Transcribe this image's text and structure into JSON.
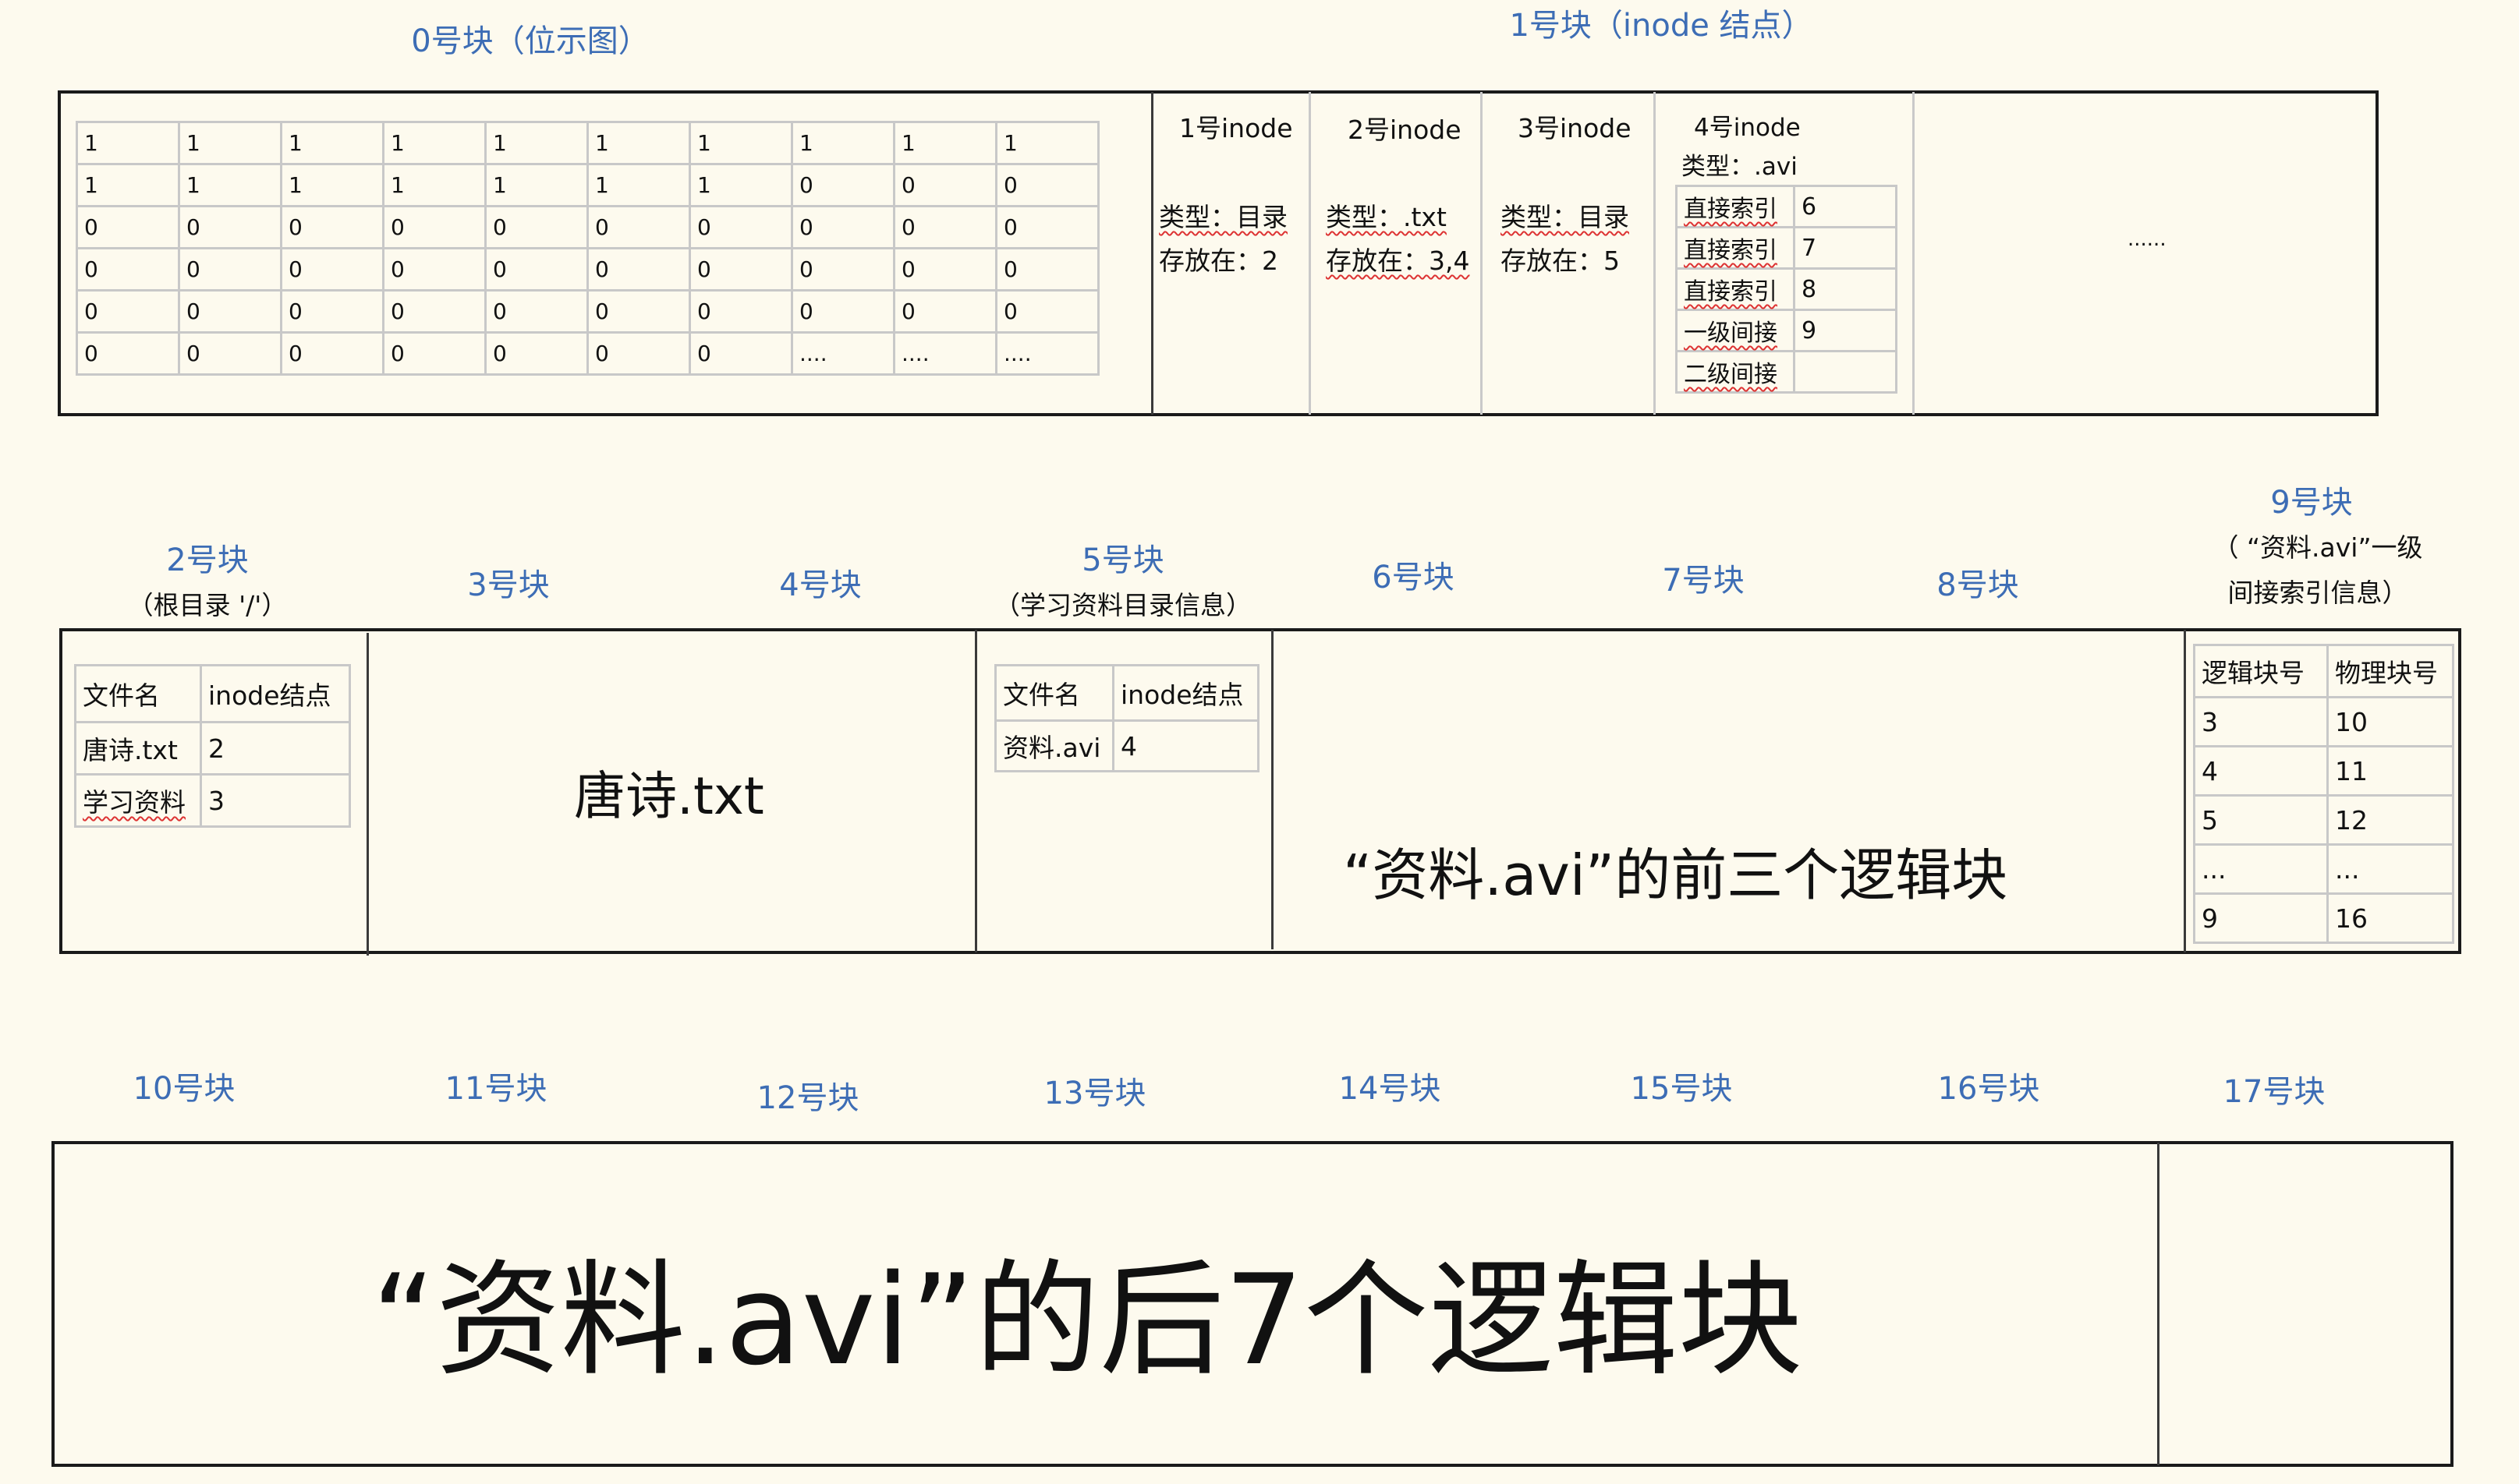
{
  "top": {
    "block0_label": "0号块（位示图）",
    "block1_label": "1号块（inode 结点）",
    "bitmap": [
      [
        "1",
        "1",
        "1",
        "1",
        "1",
        "1",
        "1",
        "1",
        "1",
        "1"
      ],
      [
        "1",
        "1",
        "1",
        "1",
        "1",
        "1",
        "1",
        "0",
        "0",
        "0"
      ],
      [
        "0",
        "0",
        "0",
        "0",
        "0",
        "0",
        "0",
        "0",
        "0",
        "0"
      ],
      [
        "0",
        "0",
        "0",
        "0",
        "0",
        "0",
        "0",
        "0",
        "0",
        "0"
      ],
      [
        "0",
        "0",
        "0",
        "0",
        "0",
        "0",
        "0",
        "0",
        "0",
        "0"
      ],
      [
        "0",
        "0",
        "0",
        "0",
        "0",
        "0",
        "0",
        "....",
        "....",
        "...."
      ]
    ],
    "inodes": [
      {
        "title": "1号inode",
        "type": "类型：目录",
        "stored": "存放在：2"
      },
      {
        "title": "2号inode",
        "type": "类型：.txt",
        "stored": "存放在：3,4"
      },
      {
        "title": "3号inode",
        "type": "类型：目录",
        "stored": "存放在：5"
      }
    ],
    "inode4": {
      "title": "4号inode",
      "type": "类型：.avi",
      "rows": [
        {
          "k": "直接索引",
          "v": "6"
        },
        {
          "k": "直接索引",
          "v": "7"
        },
        {
          "k": "直接索引",
          "v": "8"
        },
        {
          "k": "一级间接",
          "v": "9"
        },
        {
          "k": "二级间接",
          "v": ""
        }
      ]
    },
    "ellipsis": "......"
  },
  "middle": {
    "labels": {
      "b2": "2号块",
      "b2_sub": "（根目录 '/'）",
      "b3": "3号块",
      "b4": "4号块",
      "b5": "5号块",
      "b5_sub": "（学习资料目录信息）",
      "b6": "6号块",
      "b7": "7号块",
      "b8": "8号块",
      "b9": "9号块",
      "b9_sub1": "（ “资料.avi”一级",
      "b9_sub2": "间接索引信息）"
    },
    "root_dir": {
      "headers": [
        "文件名",
        "inode结点"
      ],
      "rows": [
        [
          "唐诗.txt",
          "2"
        ],
        [
          "学习资料",
          "3"
        ]
      ]
    },
    "tangshi": "唐诗.txt",
    "study_dir": {
      "headers": [
        "文件名",
        "inode结点"
      ],
      "rows": [
        [
          "资料.avi",
          "4"
        ]
      ]
    },
    "first_three": "“资料.avi”的前三个逻辑块",
    "index_table": {
      "headers": [
        "逻辑块号",
        "物理块号"
      ],
      "rows": [
        [
          "3",
          "10"
        ],
        [
          "4",
          "11"
        ],
        [
          "5",
          "12"
        ],
        [
          "...",
          "..."
        ],
        [
          "9",
          "16"
        ]
      ]
    }
  },
  "bottom": {
    "labels": [
      "10号块",
      "11号块",
      "12号块",
      "13号块",
      "14号块",
      "15号块",
      "16号块",
      "17号块"
    ],
    "last_seven": "“资料.avi”的后7个逻辑块"
  }
}
